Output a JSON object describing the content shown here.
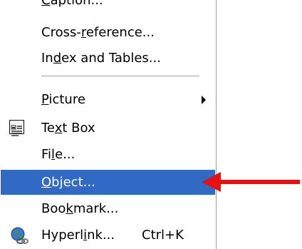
{
  "menu": {
    "items": [
      {
        "pre": "",
        "u": "C",
        "post": "aption...",
        "shortcut": ""
      },
      {
        "pre": "Cross-",
        "u": "r",
        "post": "eference...",
        "shortcut": ""
      },
      {
        "pre": "In",
        "u": "d",
        "post": "ex and Tables...",
        "shortcut": ""
      },
      {
        "pre": "",
        "u": "P",
        "post": "icture",
        "shortcut": ""
      },
      {
        "pre": "Te",
        "u": "x",
        "post": "t Box",
        "shortcut": ""
      },
      {
        "pre": "Fi",
        "u": "l",
        "post": "e...",
        "shortcut": ""
      },
      {
        "pre": "",
        "u": "O",
        "post": "bject...",
        "shortcut": ""
      },
      {
        "pre": "Boo",
        "u": "k",
        "post": "mark...",
        "shortcut": ""
      },
      {
        "pre": "Hyperl",
        "u": "i",
        "post": "nk...",
        "shortcut": "Ctrl+K"
      }
    ]
  },
  "colors": {
    "selection": "#316ac5",
    "arrow": "#e81010"
  },
  "icons": {
    "picture_submenu": "chevron-right-icon",
    "text_box": "text-box-icon",
    "hyperlink": "globe-link-icon",
    "annotation": "red-arrow-icon"
  }
}
